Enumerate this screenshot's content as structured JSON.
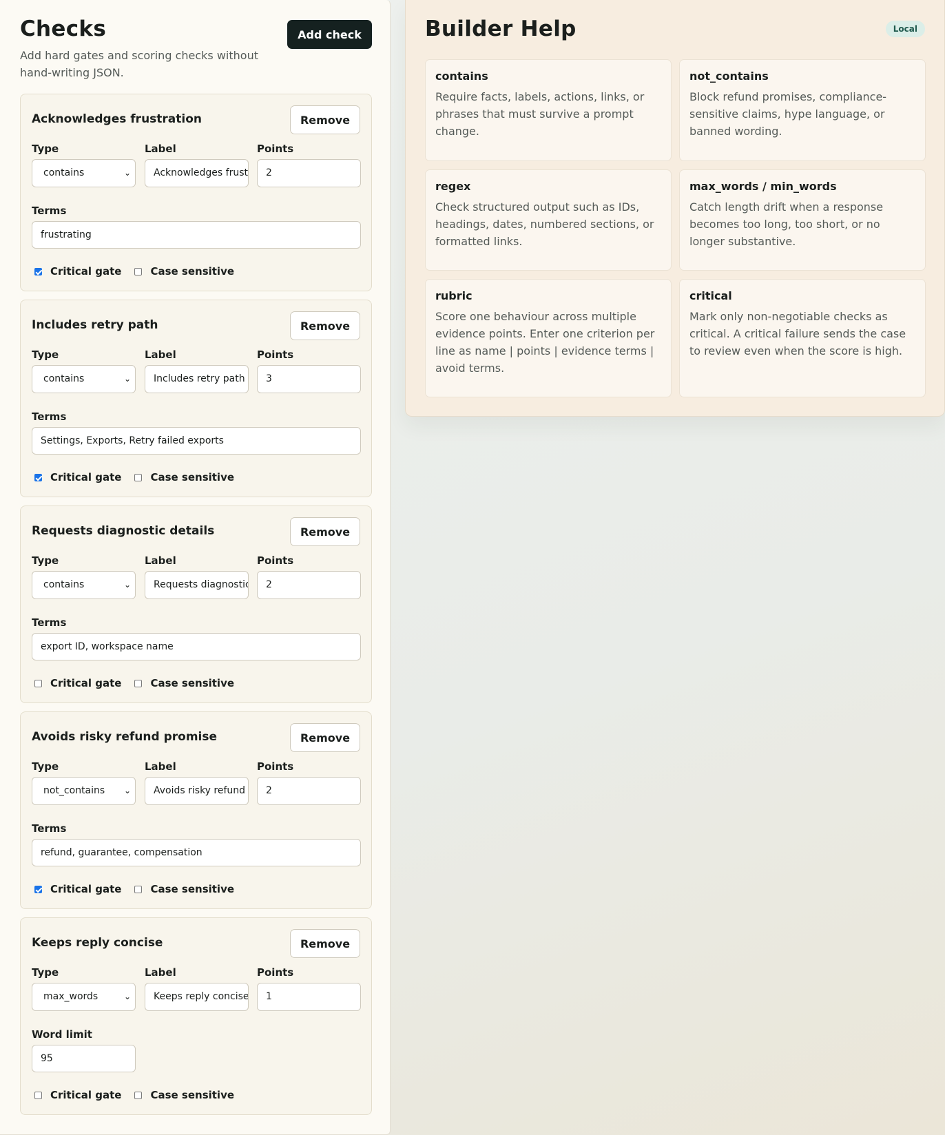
{
  "checks_panel": {
    "title": "Checks",
    "subtitle": "Add hard gates and scoring checks without hand-writing JSON.",
    "add_button": "Add check"
  },
  "common": {
    "remove": "Remove",
    "type": "Type",
    "label": "Label",
    "points": "Points",
    "terms": "Terms",
    "word_limit": "Word limit",
    "critical_gate": "Critical gate",
    "case_sensitive": "Case sensitive"
  },
  "cards": [
    {
      "title": "Acknowledges frustration",
      "type": "contains",
      "label": "Acknowledges frustration",
      "points": "2",
      "terms": "frustrating",
      "critical": true,
      "case_sensitive": false
    },
    {
      "title": "Includes retry path",
      "type": "contains",
      "label": "Includes retry path",
      "points": "3",
      "terms": "Settings, Exports, Retry failed exports",
      "critical": true,
      "case_sensitive": false
    },
    {
      "title": "Requests diagnostic details",
      "type": "contains",
      "label": "Requests diagnostic details",
      "points": "2",
      "terms": "export ID, workspace name",
      "critical": false,
      "case_sensitive": false
    },
    {
      "title": "Avoids risky refund promise",
      "type": "not_contains",
      "label": "Avoids risky refund promise",
      "points": "2",
      "terms": "refund, guarantee, compensation",
      "critical": true,
      "case_sensitive": false
    },
    {
      "title": "Keeps reply concise",
      "type": "max_words",
      "label": "Keeps reply concise",
      "points": "1",
      "word_limit": "95",
      "critical": false,
      "case_sensitive": false
    }
  ],
  "help_panel": {
    "title": "Builder Help",
    "badge": "Local",
    "items": [
      {
        "title": "contains",
        "desc": "Require facts, labels, actions, links, or phrases that must survive a prompt change."
      },
      {
        "title": "not_contains",
        "desc": "Block refund promises, compliance-sensitive claims, hype language, or banned wording."
      },
      {
        "title": "regex",
        "desc": "Check structured output such as IDs, headings, dates, numbered sections, or formatted links."
      },
      {
        "title": "max_words / min_words",
        "desc": "Catch length drift when a response becomes too long, too short, or no longer substantive."
      },
      {
        "title": "rubric",
        "desc": "Score one behaviour across multiple evidence points. Enter one criterion per line as name | points | evidence terms | avoid terms."
      },
      {
        "title": "critical",
        "desc": "Mark only non-negotiable checks as critical. A critical failure sends the case to review even when the score is high."
      }
    ]
  }
}
